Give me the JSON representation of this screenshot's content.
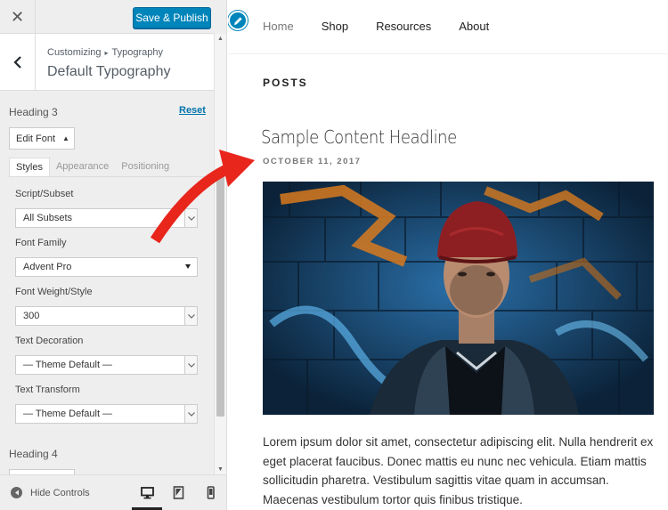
{
  "sidebar": {
    "publish_label": "Save & Publish",
    "breadcrumb": {
      "parent": "Customizing",
      "separator": "▸",
      "child": "Typography",
      "title": "Default Typography"
    },
    "section": {
      "heading": "Heading 3",
      "reset_label": "Reset",
      "edit_font_label": "Edit Font"
    },
    "tabs": [
      {
        "label": "Styles",
        "active": true
      },
      {
        "label": "Appearance",
        "active": false
      },
      {
        "label": "Positioning",
        "active": false
      }
    ],
    "fields": {
      "script": {
        "label": "Script/Subset",
        "value": "All Subsets"
      },
      "family": {
        "label": "Font Family",
        "value": "Advent Pro"
      },
      "weight": {
        "label": "Font Weight/Style",
        "value": "300"
      },
      "decoration": {
        "label": "Text Decoration",
        "value": "— Theme Default —"
      },
      "transform": {
        "label": "Text Transform",
        "value": "— Theme Default —"
      }
    },
    "next_section": "Heading 4",
    "footer": {
      "hide_controls_label": "Hide Controls"
    }
  },
  "preview": {
    "nav": [
      "Home",
      "Shop",
      "Resources",
      "About"
    ],
    "posts_heading": "POSTS",
    "post": {
      "title": "Sample Content Headline",
      "date": "OCTOBER 11, 2017",
      "excerpt": "Lorem ipsum dolor sit amet, consectetur adipiscing elit. Nulla hendrerit ex eget placerat faucibus. Donec mattis eu nunc nec vehicula. Etiam mattis sollicitudin pharetra. Vestibulum sagittis vitae quam in accumsan. Maecenas vestibulum tortor quis finibus tristique."
    }
  },
  "icons": {
    "close": "close-icon",
    "back": "chevron-left-icon",
    "edit": "pencil-icon",
    "desktop": "desktop-icon",
    "tablet": "tablet-icon",
    "mobile": "mobile-icon"
  },
  "colors": {
    "accent": "#0085ba",
    "link": "#0073aa",
    "annotation": "#e8261c"
  }
}
